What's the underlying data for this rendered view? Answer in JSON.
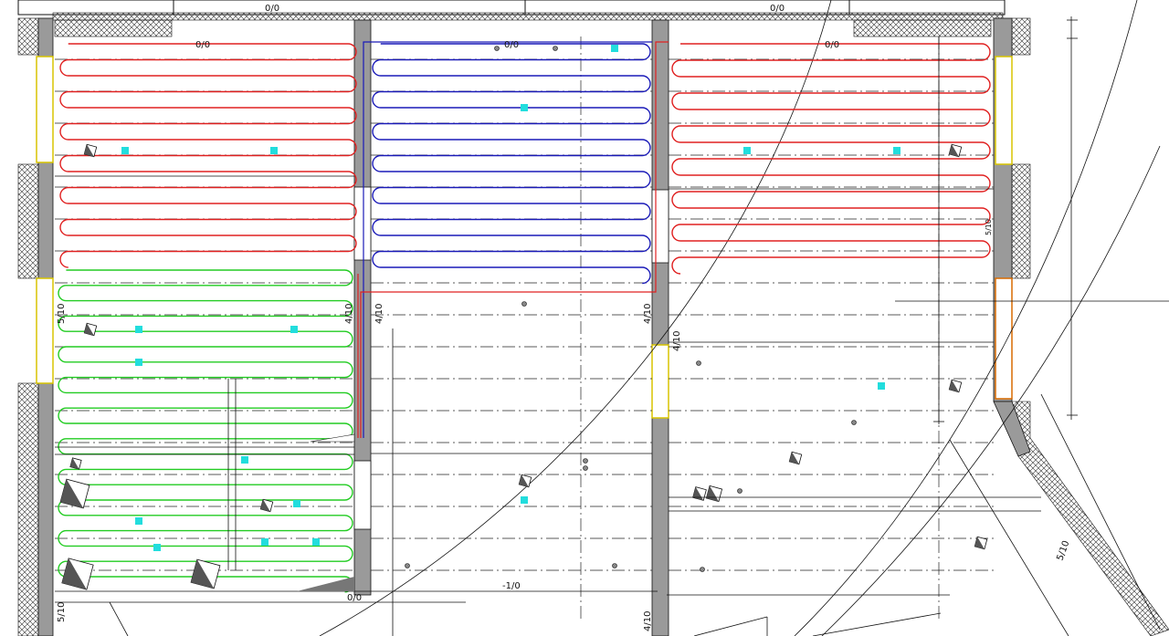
{
  "drawing": {
    "labels": {
      "top_left": "0/0",
      "top_right": "0/0",
      "room_left": "0/0",
      "room_mid": "0/0",
      "room_right": "0/0",
      "wall_left": "5/10",
      "wall_center_left_a": "4/10",
      "wall_center_left_b": "4/10",
      "wall_center_right": "4/10",
      "wall_right_inner": "4/10",
      "bottom_center": "0/0",
      "bottom_level": "-1/0",
      "bottom_left": "5/10",
      "bottom_center_right": "4/10",
      "diag_right": "5/10",
      "right_small": "5/10"
    },
    "colors": {
      "loop_red": "#e02020",
      "loop_blue": "#1a1ab8",
      "loop_green": "#22cc22",
      "marker_cyan": "#22dddd",
      "wall_fill": "#9a9a9a",
      "window_yellow": "#d8c400",
      "window_orange": "#d86a00",
      "line": "#111111"
    },
    "legend": []
  }
}
